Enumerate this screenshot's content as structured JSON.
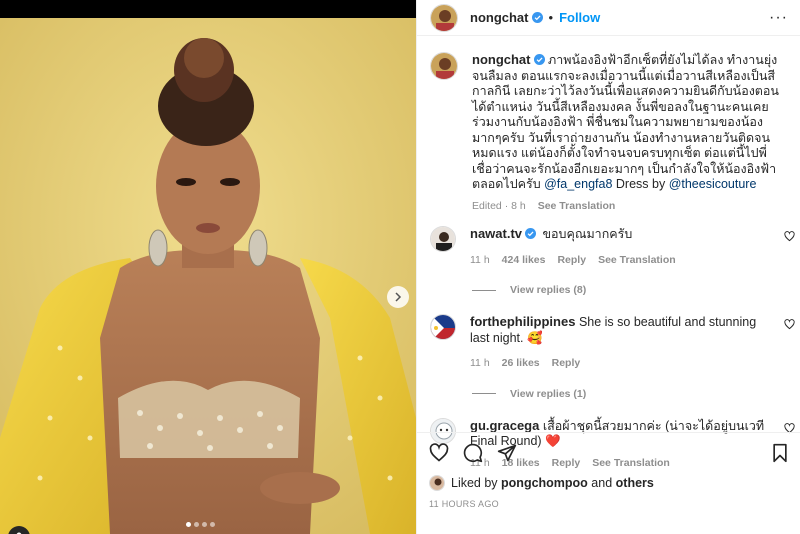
{
  "post": {
    "username": "nongchat",
    "follow_label": "Follow",
    "separator": "•",
    "more_label": "···",
    "carousel_dots": 4
  },
  "caption": {
    "username": "nongchat",
    "text": "ภาพน้องอิงฟ้าอีกเซ็ตที่ยังไม่ได้ลง ทำงานยุ่งจนลืมลง ตอนแรกจะลงเมื่อวานนี้แต่เมื่อวานสีเหลืองเป็นสีกาลกินี เลยกะว่าไว้ลงวันนี้เพื่อแสดงความยินดีกับน้องตอนได้ตำแหน่ง วันนี้สีเหลืองมงคล งั้นพี่ขอลงในฐานะคนเคยร่วมงานกับน้องอิงฟ้า พี่ชื่นชมในความพยายามของน้องมากๆครับ วันที่เราถ่ายงานกัน น้องทำงานหลายวันติดจนหมดแรง แต่น้องก็ตั้งใจทำจนจบครบทุกเซ็ต ต่อแต่นี้ไปพี่เชื่อว่าคนจะรักน้องอีกเยอะมากๆ เป็นกำลังใจให้น้องอิงฟ้าตลอดไปครับ ",
    "mention1": "@fa_engfa8",
    "text2": " Dress by ",
    "mention2": "@theesicouture",
    "edited": "Edited · 8 h",
    "see_translation": "See Translation"
  },
  "comments": [
    {
      "username": "nawat.tv",
      "text": "ขอบคุณมากครับ",
      "time": "11 h",
      "likes": "424 likes",
      "reply": "Reply",
      "see_translation": "See Translation",
      "view_replies": "View replies (8)"
    },
    {
      "username": "forthephilippines",
      "text": "She is so beautiful and stunning last night. 🥰",
      "time": "11 h",
      "likes": "26 likes",
      "reply": "Reply",
      "view_replies": "View replies (1)"
    },
    {
      "username": "gu.gracega",
      "text": "เสื้อผ้าชุดนี้สวยมากค่ะ (น่าจะได้อยู่บนเวที Final Round) ❤️",
      "time": "11 h",
      "likes": "18 likes",
      "reply": "Reply",
      "see_translation": "See Translation"
    }
  ],
  "likes": {
    "liked_by": "Liked by ",
    "user": "pongchompoo",
    "and": " and ",
    "others": "others"
  },
  "time_ago": "11 HOURS AGO",
  "icons": {
    "like": "heart-icon",
    "comment": "comment-icon",
    "share": "share-icon",
    "save": "bookmark-icon",
    "next": "chevron-right-icon",
    "tag": "user-tag-icon"
  },
  "colors": {
    "accent": "#0095f6",
    "link": "#00376b",
    "muted": "#8e8e8e",
    "photo_bg": "#e6cf7a",
    "verified": "#3897f0"
  }
}
